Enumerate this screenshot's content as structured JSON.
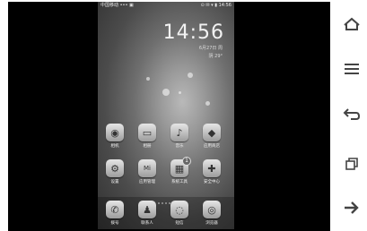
{
  "statusbar": {
    "left": "中国移动 ••• ▣",
    "right": "⊙ ✉ ▾ ▮ 14:56"
  },
  "lockinfo": {
    "time": "14:56",
    "date": "6月27日 周",
    "weather": "阴 29°"
  },
  "apps": [
    {
      "label": "相机",
      "icon": "camera-icon",
      "glyph": "◉"
    },
    {
      "label": "相册",
      "icon": "gallery-icon",
      "glyph": "▭"
    },
    {
      "label": "音乐",
      "icon": "music-icon",
      "glyph": "♪"
    },
    {
      "label": "应用商店",
      "icon": "store-icon",
      "glyph": "◆"
    },
    {
      "label": "设置",
      "icon": "gear-icon",
      "glyph": "⚙"
    },
    {
      "label": "应用管理",
      "icon": "app-manager-icon",
      "glyph": "Mi"
    },
    {
      "label": "系统工具",
      "icon": "tools-folder-icon",
      "glyph": "▦",
      "badge": "1"
    },
    {
      "label": "安全中心",
      "icon": "security-icon",
      "glyph": "✚"
    }
  ],
  "dock": [
    {
      "label": "拨号",
      "icon": "phone-icon",
      "glyph": "✆"
    },
    {
      "label": "联系人",
      "icon": "contacts-icon",
      "glyph": "♟"
    },
    {
      "label": "短信",
      "icon": "message-icon",
      "glyph": "◌"
    },
    {
      "label": "浏览器",
      "icon": "browser-icon",
      "glyph": "◎"
    }
  ],
  "navbar": [
    "home-icon",
    "menu-icon",
    "back-icon",
    "recent-icon",
    "forward-icon"
  ]
}
